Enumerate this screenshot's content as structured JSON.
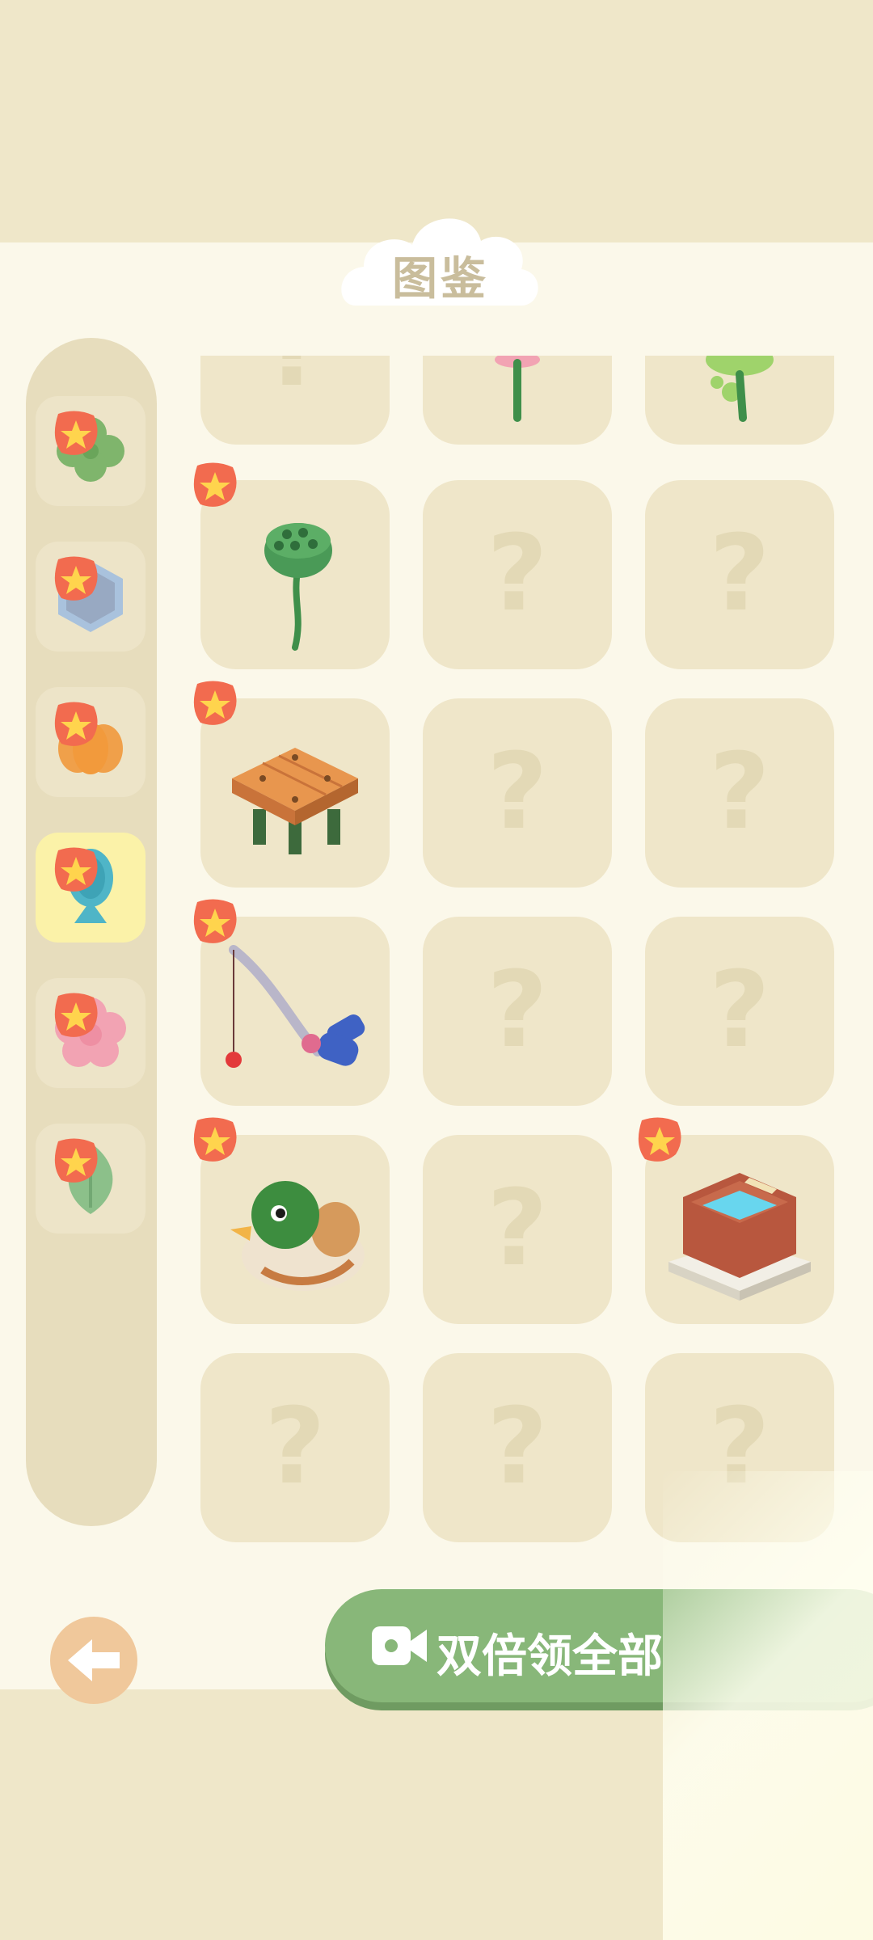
{
  "header": {
    "title": "图鉴"
  },
  "categories": [
    {
      "icon": "clover-icon",
      "selected": false
    },
    {
      "icon": "hexagon-stone-icon",
      "selected": false
    },
    {
      "icon": "pumpkin-icon",
      "selected": false
    },
    {
      "icon": "fish-icon",
      "selected": true
    },
    {
      "icon": "flower-icon",
      "selected": false
    },
    {
      "icon": "leaf-icon",
      "selected": false
    }
  ],
  "grid": {
    "unknown_mark": "?",
    "rows": [
      [
        "unknown",
        "pink-flower-stem",
        "green-plant-stem"
      ],
      [
        "lotus-seedpod",
        "unknown",
        "unknown"
      ],
      [
        "wooden-table",
        "unknown",
        "unknown"
      ],
      [
        "fishing-rod",
        "unknown",
        "unknown"
      ],
      [
        "mallard-duck",
        "unknown",
        "brick-pool"
      ],
      [
        "unknown",
        "unknown",
        "unknown"
      ]
    ]
  },
  "footer": {
    "back_icon": "arrow-left-icon",
    "double_button_label": "双倍领全部",
    "double_button_icon": "video-camera-icon"
  },
  "colors": {
    "background": "#efe7c9",
    "panel": "#fbf8ea",
    "accent_green": "#88b779",
    "star_badge": "#f26b4f",
    "star": "#ffd44d"
  }
}
